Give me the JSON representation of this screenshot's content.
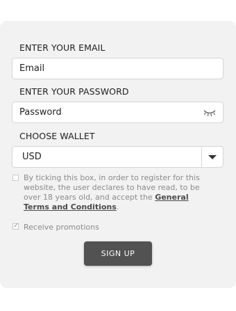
{
  "form": {
    "email_label": "ENTER YOUR EMAIL",
    "email_placeholder": "Email",
    "password_label": "ENTER YOUR PASSWORD",
    "password_placeholder": "Password",
    "password_toggle_icon": "eye-closed-icon",
    "wallet_label": "CHOOSE WALLET",
    "wallet_selected": "USD",
    "terms_text_before": "By ticking this box, in order to register for this website, the user declares to have read, to be over 18 years old, and accept the ",
    "terms_link": "General Terms and Conditions",
    "terms_text_after": ".",
    "promotions_label": "Receive promotions",
    "promotions_checked": true,
    "submit_label": "SIGN UP"
  }
}
